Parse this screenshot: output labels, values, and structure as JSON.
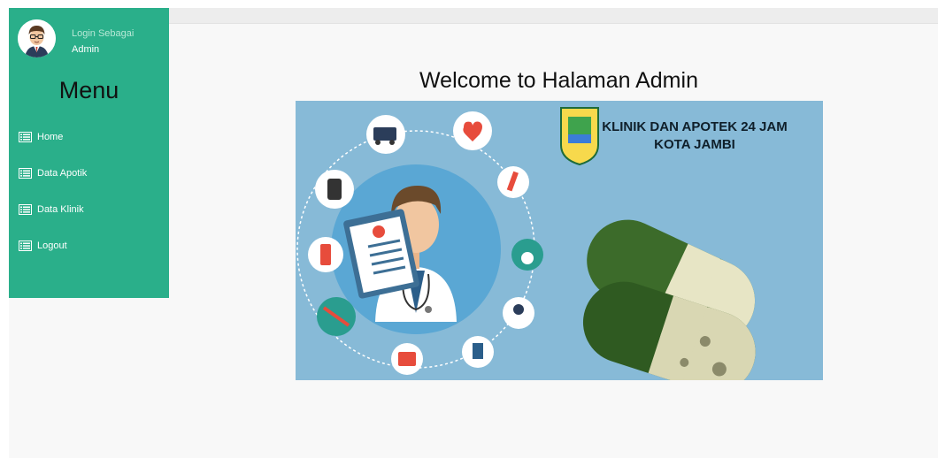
{
  "sidebar": {
    "login_label": "Login Sebagai",
    "login_user": "Admin",
    "menu_title": "Menu",
    "items": [
      {
        "label": "Home",
        "icon": "list-icon"
      },
      {
        "label": "Data Apotik",
        "icon": "list-icon"
      },
      {
        "label": "Data Klinik",
        "icon": "list-icon"
      },
      {
        "label": "Logout",
        "icon": "list-icon"
      }
    ]
  },
  "main": {
    "welcome": "Welcome to Halaman Admin",
    "banner_title_line1": "KLINIK DAN APOTEK 24 JAM",
    "banner_title_line2": "KOTA JAMBI"
  },
  "colors": {
    "sidebar": "#2aaf8a",
    "banner": "#87bad7"
  }
}
